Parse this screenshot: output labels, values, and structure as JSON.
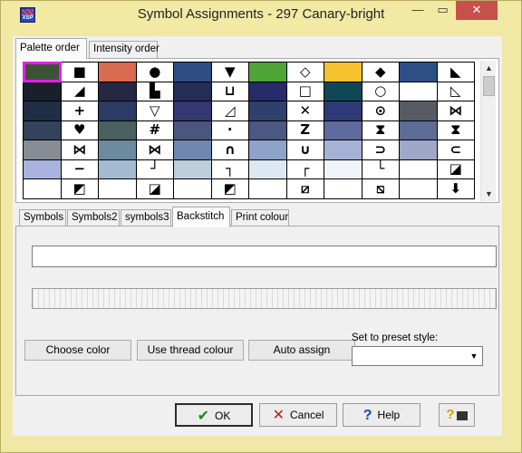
{
  "window": {
    "title": "Symbol Assignments - 297 Canary-bright",
    "icon_text": "XSP",
    "controls": {
      "minimize": "—",
      "maximize": "▭",
      "close": "✕"
    },
    "accent": "#f2eaa4"
  },
  "top_tabs": [
    {
      "label": "Palette order",
      "active": true
    },
    {
      "label": "Intensity order",
      "active": false
    }
  ],
  "grid": {
    "rows": [
      [
        {
          "c": "#3b5238",
          "s": "",
          "sel": true
        },
        {
          "c": "#ffffff",
          "s": "■"
        },
        {
          "c": "#d86a4d",
          "s": ""
        },
        {
          "c": "#ffffff",
          "s": "●"
        },
        {
          "c": "#2f4c84",
          "s": ""
        },
        {
          "c": "#ffffff",
          "s": "▼"
        },
        {
          "c": "#4fa536",
          "s": ""
        },
        {
          "c": "#ffffff",
          "s": "◇"
        },
        {
          "c": "#f7c22f",
          "s": ""
        },
        {
          "c": "#ffffff",
          "s": "◆"
        },
        {
          "c": "#2d4f86",
          "s": ""
        },
        {
          "c": "#ffffff",
          "s": "◣"
        }
      ],
      [
        {
          "c": "#1b1f2b",
          "s": ""
        },
        {
          "c": "#ffffff",
          "s": "◢"
        },
        {
          "c": "#242843",
          "s": ""
        },
        {
          "c": "#ffffff",
          "s": "▙"
        },
        {
          "c": "#242e55",
          "s": ""
        },
        {
          "c": "#ffffff",
          "s": "⊔"
        },
        {
          "c": "#262b6a",
          "s": ""
        },
        {
          "c": "#ffffff",
          "s": "□"
        },
        {
          "c": "#0f4854",
          "s": ""
        },
        {
          "c": "#ffffff",
          "s": "○"
        },
        {
          "c": "#ffffff",
          "s": ""
        },
        {
          "c": "#ffffff",
          "s": "◺"
        }
      ],
      [
        {
          "c": "#1f2d45",
          "s": ""
        },
        {
          "c": "#ffffff",
          "s": "+"
        },
        {
          "c": "#2a3b66",
          "s": ""
        },
        {
          "c": "#ffffff",
          "s": "▽"
        },
        {
          "c": "#333872",
          "s": ""
        },
        {
          "c": "#ffffff",
          "s": "◿"
        },
        {
          "c": "#2e416b",
          "s": ""
        },
        {
          "c": "#ffffff",
          "s": "✕"
        },
        {
          "c": "#2d3a77",
          "s": ""
        },
        {
          "c": "#ffffff",
          "s": "⊙"
        },
        {
          "c": "#565b64",
          "s": ""
        },
        {
          "c": "#ffffff",
          "s": "⋈"
        }
      ],
      [
        {
          "c": "#34435c",
          "s": ""
        },
        {
          "c": "#ffffff",
          "s": "♥"
        },
        {
          "c": "#4a6061",
          "s": ""
        },
        {
          "c": "#ffffff",
          "s": "#"
        },
        {
          "c": "#4b567e",
          "s": ""
        },
        {
          "c": "#ffffff",
          "s": "·"
        },
        {
          "c": "#4b5882",
          "s": ""
        },
        {
          "c": "#ffffff",
          "s": "Z"
        },
        {
          "c": "#5f6a9e",
          "s": ""
        },
        {
          "c": "#ffffff",
          "s": "⧗"
        },
        {
          "c": "#5c6c97",
          "s": ""
        },
        {
          "c": "#ffffff",
          "s": "⧗"
        }
      ],
      [
        {
          "c": "#888c94",
          "s": ""
        },
        {
          "c": "#ffffff",
          "s": "⋈"
        },
        {
          "c": "#6d8ba0",
          "s": ""
        },
        {
          "c": "#ffffff",
          "s": "⋈"
        },
        {
          "c": "#7087b0",
          "s": ""
        },
        {
          "c": "#ffffff",
          "s": "∩"
        },
        {
          "c": "#8ea3c9",
          "s": ""
        },
        {
          "c": "#ffffff",
          "s": "∪"
        },
        {
          "c": "#a6b2d5",
          "s": ""
        },
        {
          "c": "#ffffff",
          "s": "⊃"
        },
        {
          "c": "#a0a8c8",
          "s": ""
        },
        {
          "c": "#ffffff",
          "s": "⊂"
        }
      ],
      [
        {
          "c": "#a9b3de",
          "s": ""
        },
        {
          "c": "#ffffff",
          "s": "−"
        },
        {
          "c": "#a3bcd1",
          "s": ""
        },
        {
          "c": "#ffffff",
          "s": "┘"
        },
        {
          "c": "#bdcfdb",
          "s": ""
        },
        {
          "c": "#ffffff",
          "s": "┐"
        },
        {
          "c": "#dde9f2",
          "s": ""
        },
        {
          "c": "#ffffff",
          "s": "┌"
        },
        {
          "c": "#f1f3fb",
          "s": ""
        },
        {
          "c": "#ffffff",
          "s": "└"
        },
        {
          "c": "#ffffff",
          "s": ""
        },
        {
          "c": "#ffffff",
          "s": "◪"
        }
      ],
      [
        {
          "c": "#ffffff",
          "s": ""
        },
        {
          "c": "#ffffff",
          "s": "◩"
        },
        {
          "c": "#ffffff",
          "s": ""
        },
        {
          "c": "#ffffff",
          "s": "◪"
        },
        {
          "c": "#ffffff",
          "s": ""
        },
        {
          "c": "#ffffff",
          "s": "◩"
        },
        {
          "c": "#ffffff",
          "s": ""
        },
        {
          "c": "#ffffff",
          "s": "⧄"
        },
        {
          "c": "#ffffff",
          "s": ""
        },
        {
          "c": "#ffffff",
          "s": "⧅"
        },
        {
          "c": "#ffffff",
          "s": ""
        },
        {
          "c": "#ffffff",
          "s": "⬇"
        }
      ]
    ]
  },
  "scrollbar": {
    "up": "▲",
    "down": "▼"
  },
  "symbol_tabs": [
    {
      "label": "Symbols",
      "active": false
    },
    {
      "label": "Symbols2",
      "active": false
    },
    {
      "label": "symbols3",
      "active": false
    },
    {
      "label": "Backstitch",
      "active": true
    },
    {
      "label": "Print colour",
      "active": false
    }
  ],
  "backstitch": {
    "input_value": "",
    "buttons": {
      "choose_color": "Choose color",
      "use_thread_colour": "Use thread colour",
      "auto_assign": "Auto assign"
    },
    "preset_label": "Set to preset style:",
    "preset_value": "",
    "preset_arrow": "▼"
  },
  "footer": {
    "ok": "OK",
    "cancel": "Cancel",
    "help": "Help",
    "ok_icon": "✔",
    "cancel_icon": "✕",
    "help_icon": "?",
    "lang_icon": "?"
  }
}
